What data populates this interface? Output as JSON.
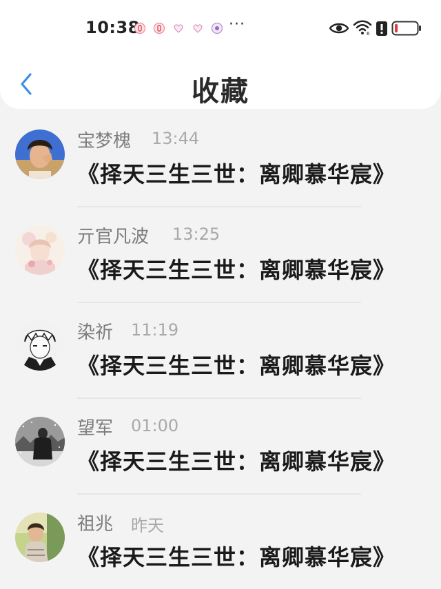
{
  "status_bar": {
    "time": "10:38",
    "more": "···",
    "icons": [
      "eye-icon",
      "wifi-icon",
      "battery-saver-icon",
      "battery-low-icon"
    ],
    "notification_icons": [
      "app-notif-1",
      "app-notif-2",
      "heart-notif-1",
      "heart-notif-2",
      "app-notif-3"
    ]
  },
  "nav": {
    "back_icon": "chevron-left-icon",
    "title": "收藏",
    "accent_color": "#3d8fe6"
  },
  "items": [
    {
      "name": "宝梦槐",
      "time": "13:44",
      "text": "《择天三生三世：离卿慕华宸》",
      "avatar": "avatar-boy-portrait"
    },
    {
      "name": "亓官凡波",
      "time": "13:25",
      "text": "《择天三生三世：离卿慕华宸》",
      "avatar": "avatar-anime-girl"
    },
    {
      "name": "染祈",
      "time": "11:19",
      "text": "《择天三生三世：离卿慕华宸》",
      "avatar": "avatar-manga-boy"
    },
    {
      "name": "望军",
      "time": "01:00",
      "text": "《择天三生三世：离卿慕华宸》",
      "avatar": "avatar-snow-figure"
    },
    {
      "name": "祖兆",
      "time": "昨天",
      "text": "《择天三生三世：离卿慕华宸》",
      "avatar": "avatar-boy-outdoor"
    }
  ]
}
